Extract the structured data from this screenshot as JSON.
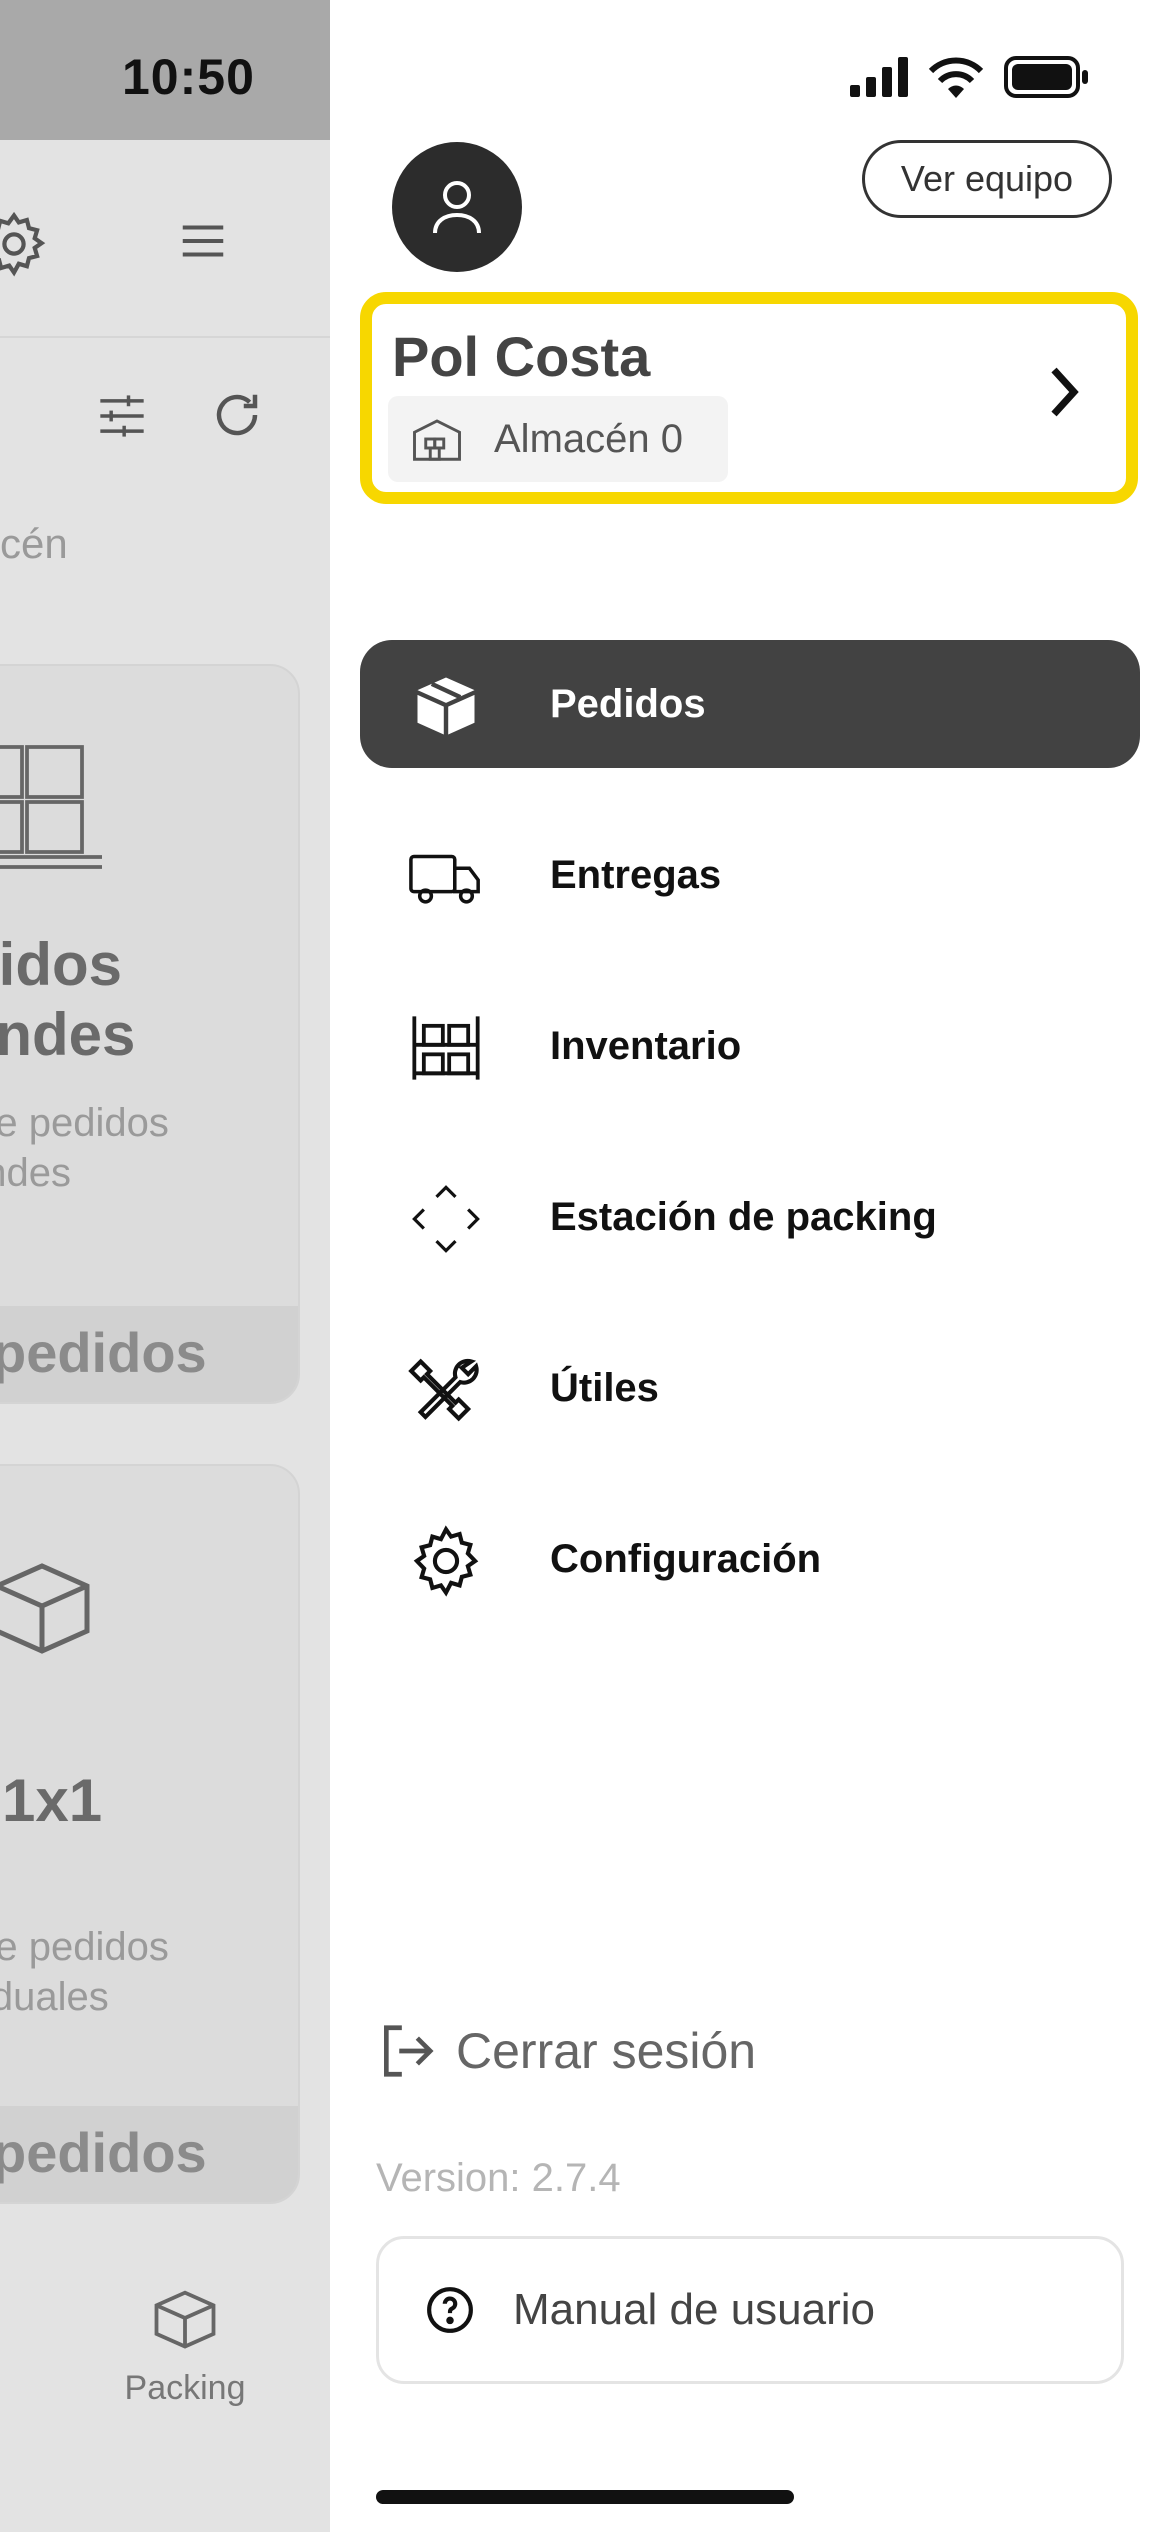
{
  "status_bar": {
    "time": "10:50"
  },
  "background": {
    "filter_label": "cén",
    "cards": [
      {
        "title": "didos\nandes",
        "subtitle": " de pedidos\nandes",
        "count_label": "pedidos"
      },
      {
        "title": "1x1",
        "subtitle": " de pedidos\nviduales",
        "count_label": "pedidos"
      }
    ],
    "tab_packing": "Packing"
  },
  "drawer": {
    "ver_equipo": "Ver equipo",
    "user": {
      "name": "Pol Costa",
      "warehouse": "Almacén 0"
    },
    "menu": [
      {
        "label": "Pedidos",
        "icon": "box-icon",
        "active": true
      },
      {
        "label": "Entregas",
        "icon": "truck-icon",
        "active": false
      },
      {
        "label": "Inventario",
        "icon": "shelves-icon",
        "active": false
      },
      {
        "label": "Estación de packing",
        "icon": "arrows-diamond-icon",
        "active": false
      },
      {
        "label": "Útiles",
        "icon": "tools-icon",
        "active": false
      },
      {
        "label": "Configuración",
        "icon": "gear-icon",
        "active": false
      }
    ],
    "logout": "Cerrar sesión",
    "version": "Version: 2.7.4",
    "manual": "Manual de usuario"
  },
  "colors": {
    "highlight": "#f7d700",
    "active_item": "#424242",
    "overlay": "#e3e3e3"
  }
}
